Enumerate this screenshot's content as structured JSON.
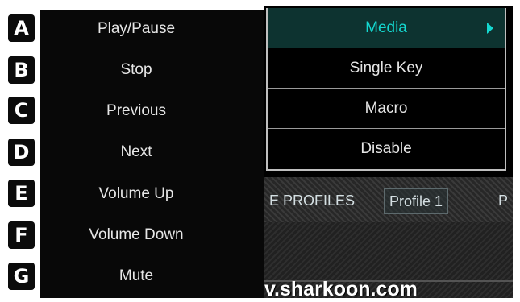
{
  "badges": [
    "A",
    "B",
    "C",
    "D",
    "E",
    "F",
    "G"
  ],
  "left_menu": {
    "items": [
      "Play/Pause",
      "Stop",
      "Previous",
      "Next",
      "Volume Up",
      "Volume Down",
      "Mute"
    ]
  },
  "right_menu": {
    "items": [
      "Media",
      "Single Key",
      "Macro",
      "Disable"
    ],
    "active_index": 0
  },
  "background": {
    "profile_tabs": [
      "E PROFILES",
      "Profile 1",
      "P"
    ],
    "url_fragment": "v.sharkoon.com"
  },
  "colors": {
    "accent": "#14d8d0",
    "menu_bg": "#000000",
    "badge_bg": "#0b0b0b"
  },
  "icons": {
    "submenu": "triangle-right-icon"
  }
}
